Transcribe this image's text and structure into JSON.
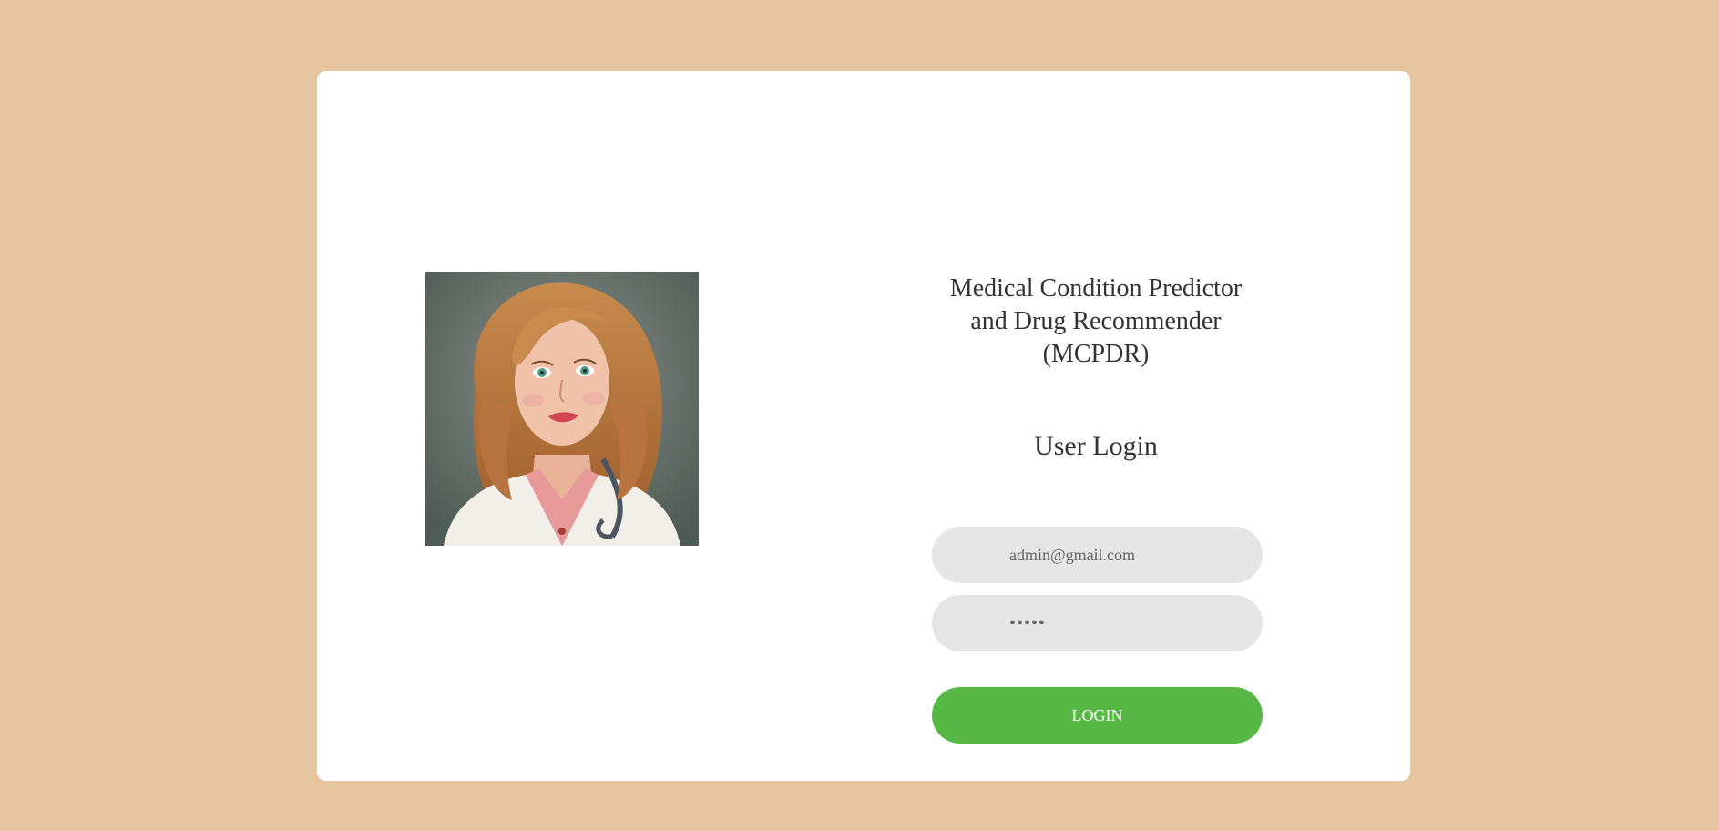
{
  "app": {
    "title_lines": [
      "Medical Condition Predictor",
      "and Drug Recommender",
      "(MCPDR)"
    ]
  },
  "login": {
    "heading": "User Login",
    "email_value": "admin@gmail.com",
    "password_value": "•••••",
    "button_label": "LOGIN"
  },
  "illustration": {
    "subject": "doctor-portrait"
  },
  "colors": {
    "page_background": "#e6c5a1",
    "card_background": "#ffffff",
    "input_background": "#e6e6e6",
    "button_background": "#57b846",
    "button_text": "#ffffff",
    "heading_text": "#333333"
  }
}
